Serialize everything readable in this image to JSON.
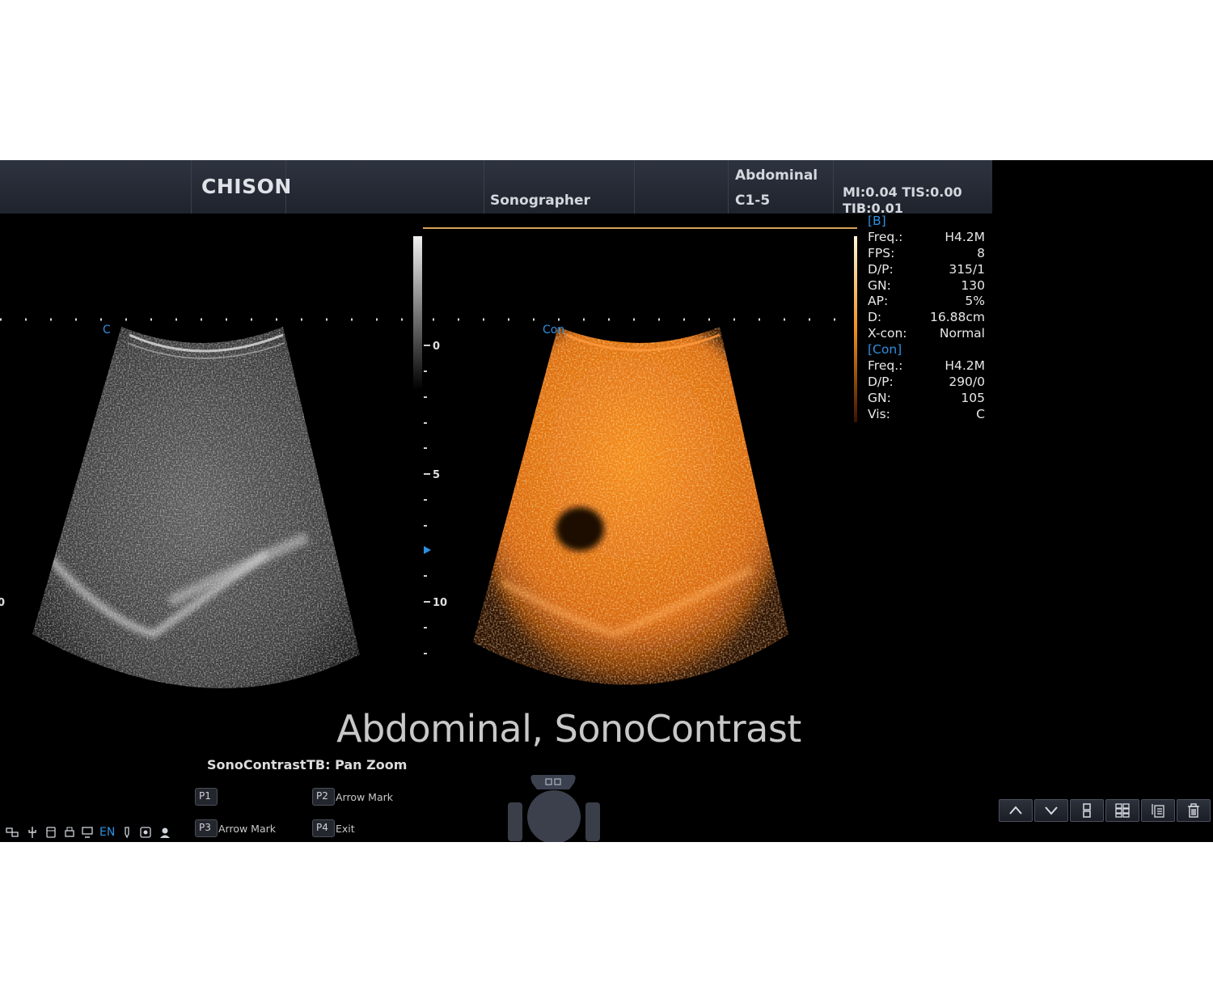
{
  "header": {
    "brand": "CHISON",
    "sonographer": "Sonographer",
    "exam": "Abdominal",
    "probe": "C1-5",
    "mi_tis": "MI:0.04 TIS:0.00",
    "tib": "TIB:0.01"
  },
  "params": {
    "b_section": "[B]",
    "b_rows": [
      {
        "k": "Freq.:",
        "v": "H4.2M"
      },
      {
        "k": "FPS:",
        "v": "8"
      },
      {
        "k": "D/P:",
        "v": "315/1"
      },
      {
        "k": "GN:",
        "v": "130"
      },
      {
        "k": "AP:",
        "v": "5%"
      },
      {
        "k": "D:",
        "v": "16.88cm"
      },
      {
        "k": "X-con:",
        "v": "Normal"
      }
    ],
    "con_section": "[Con]",
    "con_rows": [
      {
        "k": "Freq.:",
        "v": "H4.2M"
      },
      {
        "k": "D/P:",
        "v": "290/0"
      },
      {
        "k": "GN:",
        "v": "105"
      },
      {
        "k": "Vis:",
        "v": "C"
      }
    ]
  },
  "images": {
    "left_label": "C",
    "right_label": "Con",
    "depth_scale": [
      "0",
      "5",
      "10"
    ],
    "left_edge_tick": "0"
  },
  "caption": "Abdominal, SonoContrast",
  "menu": {
    "mode": "SonoContrast",
    "tb": "TB: Pan Zoom",
    "p1": {
      "key": "P1",
      "label": ""
    },
    "p2": {
      "key": "P2",
      "label": "Arrow Mark"
    },
    "p3": {
      "key": "P3",
      "label": "Arrow Mark"
    },
    "p4": {
      "key": "P4",
      "label": "Exit"
    }
  },
  "status": {
    "lang": "EN"
  },
  "toolbar": [
    "chevron-up-icon",
    "chevron-down-icon",
    "layout-dual-icon",
    "layout-quad-icon",
    "image-list-icon",
    "trash-icon"
  ],
  "colors": {
    "accent_blue": "#2f8fe0",
    "contrast_orange": "#f07a12",
    "gain_line": "#d9a25a"
  }
}
